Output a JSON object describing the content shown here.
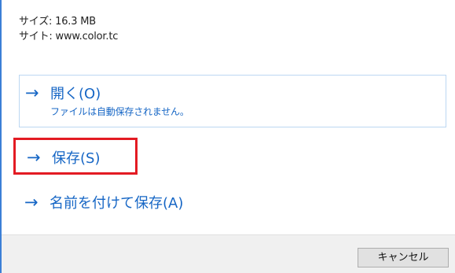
{
  "info": {
    "size_label": "サイズ:",
    "size_value": "16.3 MB",
    "site_label": "サイト:",
    "site_value": "www.color.tc"
  },
  "options": {
    "open": {
      "label": "開く(O)",
      "description": "ファイルは自動保存されません。"
    },
    "save": {
      "label": "保存(S)"
    },
    "save_as": {
      "label": "名前を付けて保存(A)"
    }
  },
  "footer": {
    "cancel_label": "キャンセル"
  },
  "icons": {
    "arrow": "arrow-right-icon"
  },
  "colors": {
    "accent": "#1666c5",
    "highlight_border": "#e31b23",
    "open_border": "#bcd7f2",
    "footer_bg": "#f0f0f0"
  }
}
